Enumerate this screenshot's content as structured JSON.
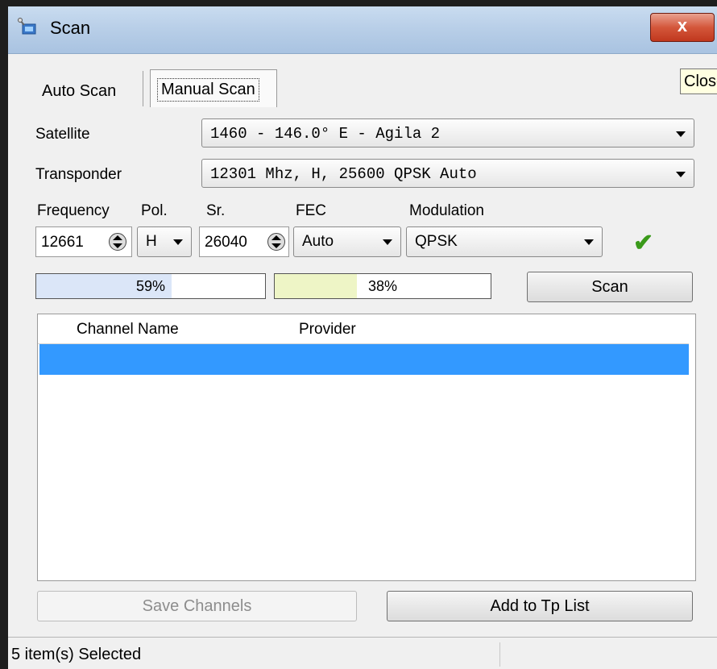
{
  "window": {
    "title": "Scan",
    "close_label": "x",
    "tooltip": "Close"
  },
  "tabs": [
    {
      "label": "Auto Scan"
    },
    {
      "label": "Manual Scan"
    }
  ],
  "satellite": {
    "label": "Satellite",
    "value": "1460 - 146.0° E - Agila 2"
  },
  "transponder": {
    "label": "Transponder",
    "value": "12301 Mhz, H, 25600   QPSK Auto"
  },
  "params": {
    "frequency": {
      "label": "Frequency",
      "value": "12661"
    },
    "pol": {
      "label": "Pol.",
      "value": "H"
    },
    "sr": {
      "label": "Sr.",
      "value": "26040"
    },
    "fec": {
      "label": "FEC",
      "value": "Auto"
    },
    "modulation": {
      "label": "Modulation",
      "value": "QPSK"
    }
  },
  "signal": {
    "strength_text": "59%",
    "strength": 0.59,
    "strength_color": "#dbe6f8",
    "quality_text": "38%",
    "quality": 0.38,
    "quality_color": "#eef5c6"
  },
  "scan_button": "Scan",
  "list": {
    "columns": [
      "Channel Name",
      "Provider"
    ],
    "selected_color": "#3399ff"
  },
  "save_button": "Save Channels",
  "add_button": "Add to Tp List",
  "status": "5 item(s) Selected"
}
